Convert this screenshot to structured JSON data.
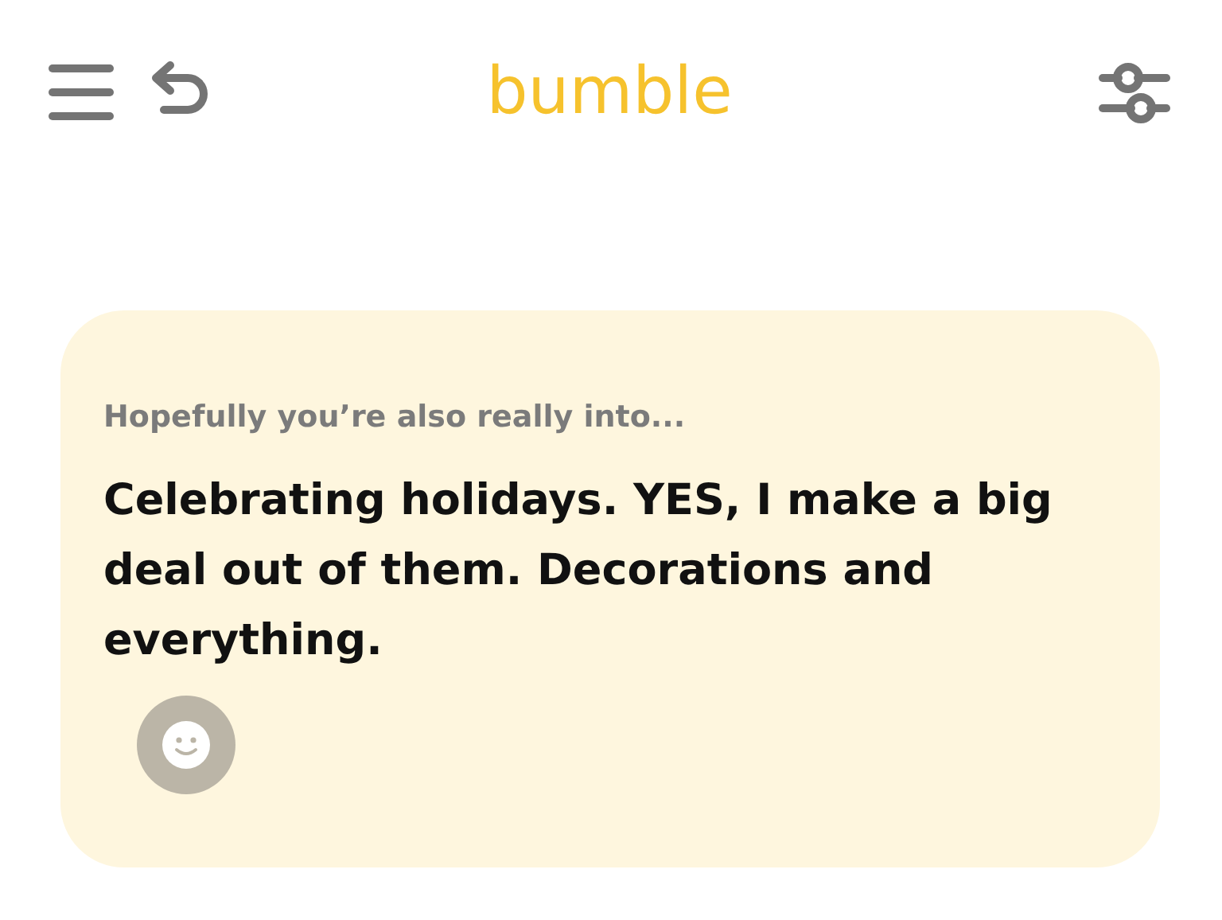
{
  "header": {
    "logo": "bumble"
  },
  "prompt_card": {
    "label": "Hopefully you’re also really into...",
    "answer": "Celebrating holidays. YES, I make a big deal out of them. Decorations and everything."
  }
}
